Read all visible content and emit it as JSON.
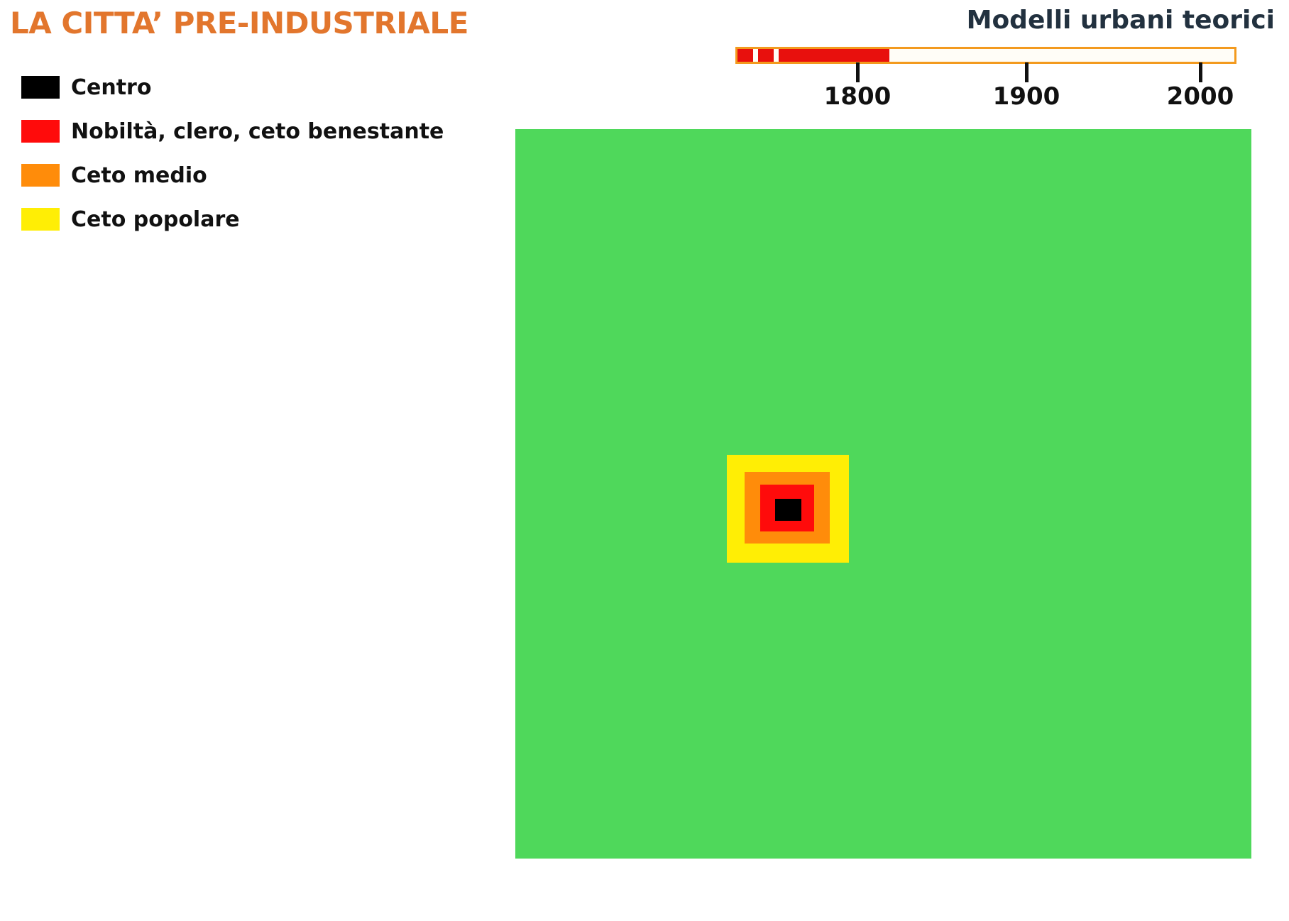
{
  "header": {
    "title": "LA CITTA’ PRE-INDUSTRIALE",
    "subtitle": "Modelli urbani teorici"
  },
  "legend": {
    "items": [
      {
        "label": "Centro",
        "color": "#000000"
      },
      {
        "label": "Nobiltà, clero, ceto benestante",
        "color": "#ff0b0b"
      },
      {
        "label": "Ceto medio",
        "color": "#ff8c0a"
      },
      {
        "label": "Ceto popolare",
        "color": "#ffee05"
      }
    ]
  },
  "timeline": {
    "ticks": [
      "1800",
      "1900",
      "2000"
    ],
    "border_color": "#f39a1e",
    "highlight_color": "#e8100d"
  },
  "map": {
    "background_color": "#4fd85b"
  }
}
